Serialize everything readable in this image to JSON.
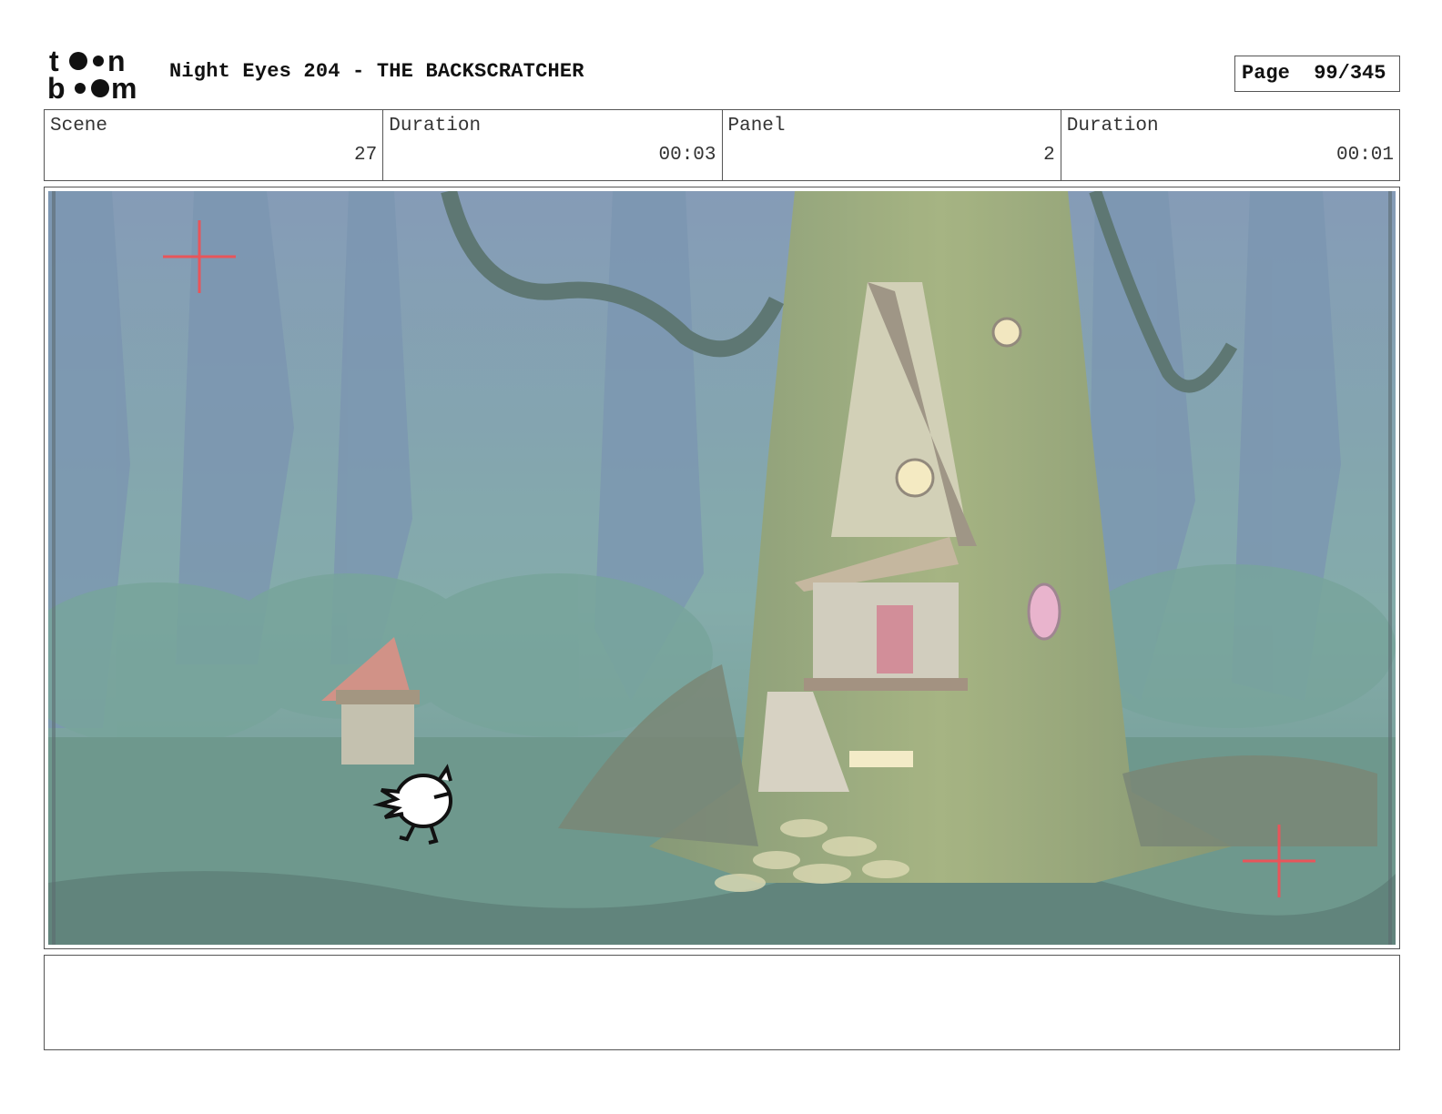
{
  "header": {
    "logo_top": "to•n",
    "logo_bottom": "b••m",
    "title": "Night Eyes 204 - THE BACKSCRATCHER",
    "page_label": "Page",
    "page_value": "99/345"
  },
  "info": {
    "scene_label": "Scene",
    "scene_value": "27",
    "scene_duration_label": "Duration",
    "scene_duration_value": "00:03",
    "panel_label": "Panel",
    "panel_value": "2",
    "panel_duration_label": "Duration",
    "panel_duration_value": "00:01"
  },
  "notes": {
    "text": ""
  },
  "colors": {
    "sky": "#6f8fae",
    "forest": "#5d8f86",
    "ground": "#4d7d72",
    "trunk": "#7c8f5c",
    "crosshair": "#e8555a"
  }
}
